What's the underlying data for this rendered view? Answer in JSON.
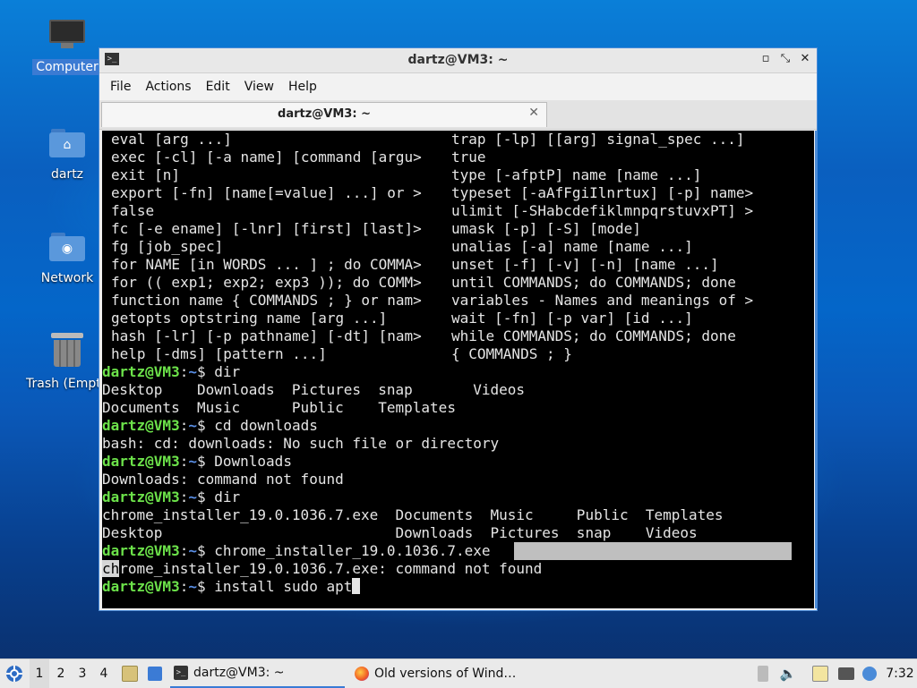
{
  "desktop": {
    "icons": [
      {
        "label": "Computer",
        "icon": "computer-icon"
      },
      {
        "label": "dartz",
        "icon": "home-folder-icon"
      },
      {
        "label": "Network",
        "icon": "network-folder-icon"
      },
      {
        "label": "Trash (Empty)",
        "icon": "trash-icon"
      }
    ]
  },
  "window": {
    "title": "dartz@VM3: ~",
    "controls": {
      "minimize": "▫",
      "maximize": "⤡",
      "close": "✕"
    },
    "menu": [
      "File",
      "Actions",
      "Edit",
      "View",
      "Help"
    ],
    "tab": {
      "label": "dartz@VM3: ~",
      "close": "✕"
    }
  },
  "terminal": {
    "help_rows": [
      [
        "eval [arg ...]",
        "trap [-lp] [[arg] signal_spec ...]"
      ],
      [
        "exec [-cl] [-a name] [command [argu>",
        "true"
      ],
      [
        "exit [n]",
        "type [-afptP] name [name ...]"
      ],
      [
        "export [-fn] [name[=value] ...] or >",
        "typeset [-aAfFgiIlnrtux] [-p] name>"
      ],
      [
        "false",
        "ulimit [-SHabcdefiklmnpqrstuvxPT] >"
      ],
      [
        "fc [-e ename] [-lnr] [first] [last]>",
        "umask [-p] [-S] [mode]"
      ],
      [
        "fg [job_spec]",
        "unalias [-a] name [name ...]"
      ],
      [
        "for NAME [in WORDS ... ] ; do COMMA>",
        "unset [-f] [-v] [-n] [name ...]"
      ],
      [
        "for (( exp1; exp2; exp3 )); do COMM>",
        "until COMMANDS; do COMMANDS; done"
      ],
      [
        "function name { COMMANDS ; } or nam>",
        "variables - Names and meanings of >"
      ],
      [
        "getopts optstring name [arg ...]",
        "wait [-fn] [-p var] [id ...]"
      ],
      [
        "hash [-lr] [-p pathname] [-dt] [nam>",
        "while COMMANDS; do COMMANDS; done"
      ],
      [
        "help [-dms] [pattern ...]",
        "{ COMMANDS ; }"
      ]
    ],
    "prompt": {
      "user": "dartz@VM3",
      "sep": ":",
      "path": "~",
      "dollar": "$ "
    },
    "cmd1": "dir",
    "out1a": "Desktop    Downloads  Pictures  snap       Videos",
    "out1b": "Documents  Music      Public    Templates",
    "cmd2": "cd downloads",
    "out2": "bash: cd: downloads: No such file or directory",
    "cmd3": "Downloads",
    "out3": "Downloads: command not found",
    "cmd4": "dir",
    "out4a": "chrome_installer_19.0.1036.7.exe  Documents  Music     Public  Templates",
    "out4b": "Desktop                           Downloads  Pictures  snap    Videos",
    "cmd5": "chrome_installer_19.0.1036.7.exe",
    "out5_sel": "ch",
    "out5_rest": "rome_installer_19.0.1036.7.exe: command not found",
    "cmd6": "install sudo apt"
  },
  "taskbar": {
    "start_icon": "start-menu-icon",
    "workspaces": [
      "1",
      "2",
      "3",
      "4"
    ],
    "tasks": [
      {
        "label": "dartz@VM3: ~",
        "icon": "terminal-icon"
      },
      {
        "label": "Old versions of Wind…",
        "icon": "firefox-icon"
      }
    ],
    "clock": "7:32"
  }
}
